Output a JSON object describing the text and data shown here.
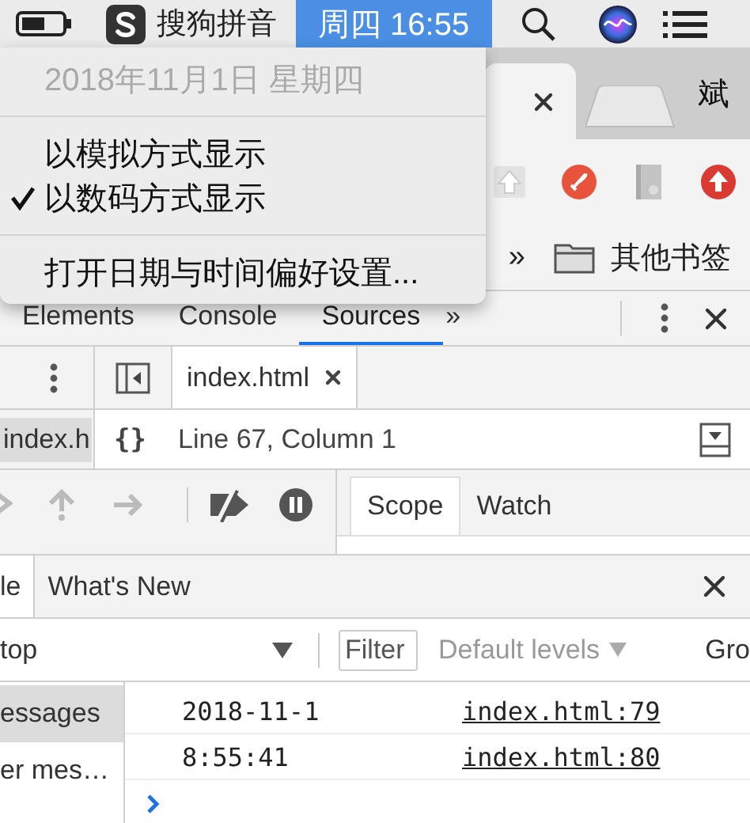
{
  "menu_bar": {
    "input_method": "搜狗拼音",
    "clock": "周四 16:55",
    "selected": true
  },
  "clock_menu": {
    "items": [
      {
        "kind": "item",
        "label": "2018年11月1日 星期四",
        "disabled": true,
        "checked": false
      },
      {
        "kind": "separator"
      },
      {
        "kind": "item",
        "label": "以模拟方式显示",
        "disabled": false,
        "checked": false
      },
      {
        "kind": "item",
        "label": "以数码方式显示",
        "disabled": false,
        "checked": true
      },
      {
        "kind": "separator"
      },
      {
        "kind": "item",
        "label": "打开日期与时间偏好设置...",
        "disabled": false,
        "checked": false
      }
    ]
  },
  "browser": {
    "profile_name": "斌",
    "bookmarks_overflow": "»",
    "bookmark_folder": "其他书签"
  },
  "devtools": {
    "tabs": [
      {
        "label": "Elements",
        "selected": false
      },
      {
        "label": "Console",
        "selected": false
      },
      {
        "label": "Sources",
        "selected": true
      }
    ],
    "more_tabs": "»",
    "navigator": {
      "file": "index.h",
      "selected": true
    },
    "editor_tabs": [
      {
        "label": "index.html",
        "selected": true
      }
    ],
    "pretty_print": "{}",
    "status": "Line 67, Column 1",
    "sidebar_tabs": [
      {
        "label": "Scope",
        "selected": true
      },
      {
        "label": "Watch",
        "selected": false
      }
    ],
    "drawer_tabs": [
      {
        "label": "le",
        "selected": true
      },
      {
        "label": "What's New",
        "selected": false
      }
    ],
    "console_toolbar": {
      "context": "top",
      "filter_placeholder": "Filter",
      "levels": "Default levels",
      "group": "Gro"
    },
    "console_sidebar": [
      {
        "label": "essages",
        "selected": true
      },
      {
        "label": "er mes…",
        "selected": false
      }
    ],
    "messages": [
      {
        "text": "2018-11-1",
        "source": "index.html:79"
      },
      {
        "text": "8:55:41",
        "source": "index.html:80"
      }
    ]
  }
}
